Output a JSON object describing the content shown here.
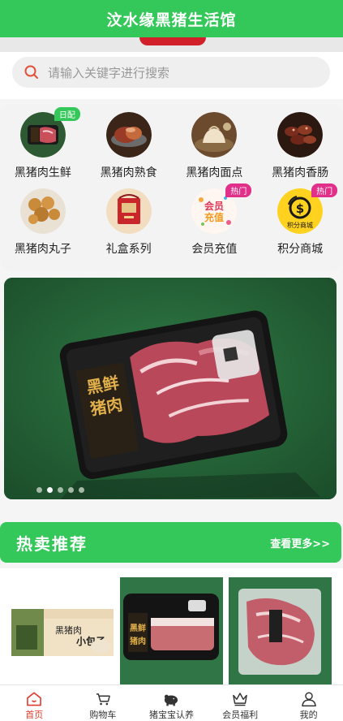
{
  "header": {
    "title": "汶水缘黑猪生活馆"
  },
  "search": {
    "placeholder": "请输入关键字进行搜索"
  },
  "categories": [
    {
      "label": "黑猪肉生鲜",
      "badge": "日配",
      "icon": "fresh-pork-icon"
    },
    {
      "label": "黑猪肉熟食",
      "badge": "",
      "icon": "cooked-pork-icon"
    },
    {
      "label": "黑猪肉面点",
      "badge": "",
      "icon": "pastry-icon"
    },
    {
      "label": "黑猪肉香肠",
      "badge": "",
      "icon": "sausage-icon"
    },
    {
      "label": "黑猪肉丸子",
      "badge": "",
      "icon": "meatball-icon"
    },
    {
      "label": "礼盒系列",
      "badge": "",
      "icon": "gift-box-icon"
    },
    {
      "label": "会员充值",
      "badge": "热门",
      "icon": "member-recharge-icon",
      "image_text": "会员充值"
    },
    {
      "label": "积分商城",
      "badge": "热门",
      "icon": "points-mall-icon",
      "image_text": "积分商城"
    }
  ],
  "banner": {
    "slide_count": 5,
    "active_index": 1,
    "package_text": "黑鲜猪肉"
  },
  "hot": {
    "title": "热卖推荐",
    "more_label": "查看更多>>"
  },
  "products": [
    {
      "icon": "pork-bun-package-icon",
      "package_text": "黑猪肉小包子"
    },
    {
      "icon": "pork-slab-package-icon",
      "package_text": "黑鲜猪肉"
    },
    {
      "icon": "pork-ribs-package-icon",
      "package_text": ""
    }
  ],
  "nav": [
    {
      "label": "首页",
      "icon": "home-icon",
      "active": true
    },
    {
      "label": "购物车",
      "icon": "cart-icon",
      "active": false
    },
    {
      "label": "猪宝宝认养",
      "icon": "piggy-icon",
      "active": false
    },
    {
      "label": "会员福利",
      "icon": "crown-icon",
      "active": false
    },
    {
      "label": "我的",
      "icon": "user-icon",
      "active": false
    }
  ],
  "colors": {
    "brand_green": "#34c759",
    "active_red": "#e03b2c",
    "hot_badge": "#e0308a"
  }
}
